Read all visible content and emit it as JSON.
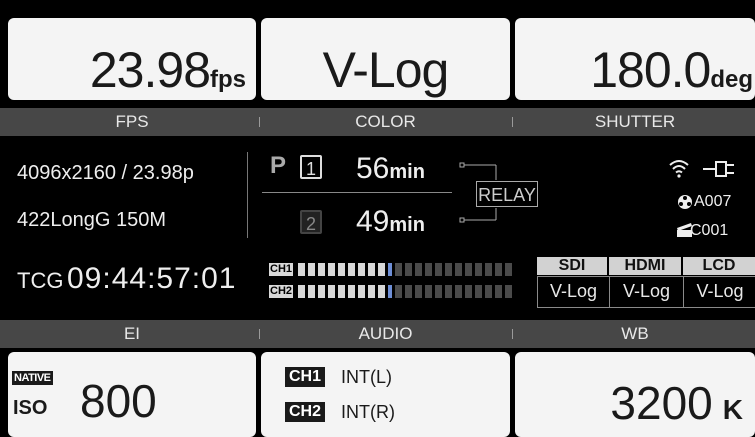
{
  "top": {
    "fps": {
      "value": "23.98",
      "unit": "fps",
      "label": "FPS"
    },
    "color": {
      "value": "V-Log",
      "label": "COLOR"
    },
    "shutter": {
      "value": "180.0",
      "unit": "deg",
      "label": "SHUTTER"
    }
  },
  "info": {
    "resolution": "4096x2160 / 23.98p",
    "codec": "422LongG 150M",
    "timecode_prefix": "TCG",
    "timecode": "09:44:57:01"
  },
  "slots": {
    "primary_marker": "P",
    "slot1": {
      "num": "1",
      "value": "56",
      "unit": "min"
    },
    "slot2": {
      "num": "2",
      "value": "49",
      "unit": "min"
    },
    "relay_label": "RELAY"
  },
  "status": {
    "clip_a": "A007",
    "clip_c": "C001",
    "icons": [
      "wifi-icon",
      "power-plug-icon",
      "reel-icon",
      "clapper-icon"
    ]
  },
  "audio_meters": {
    "ch1": {
      "label": "CH1",
      "level": 0.45
    },
    "ch2": {
      "label": "CH2",
      "level": 0.45
    }
  },
  "outputs": {
    "headers": [
      "SDI",
      "HDMI",
      "LCD"
    ],
    "values": [
      "V-Log",
      "V-Log",
      "V-Log"
    ]
  },
  "bottom": {
    "ei": {
      "label": "EI",
      "native_label": "NATIVE",
      "iso_label": "ISO",
      "value": "800"
    },
    "audio": {
      "label": "AUDIO",
      "ch1": {
        "tag": "CH1",
        "value": "INT(L)"
      },
      "ch2": {
        "tag": "CH2",
        "value": "INT(R)"
      }
    },
    "wb": {
      "label": "WB",
      "value": "3200",
      "unit": "K"
    }
  },
  "colors": {
    "tile": "#f4f4f4",
    "labelbar": "#474747",
    "peak": "#6f8fd6"
  }
}
